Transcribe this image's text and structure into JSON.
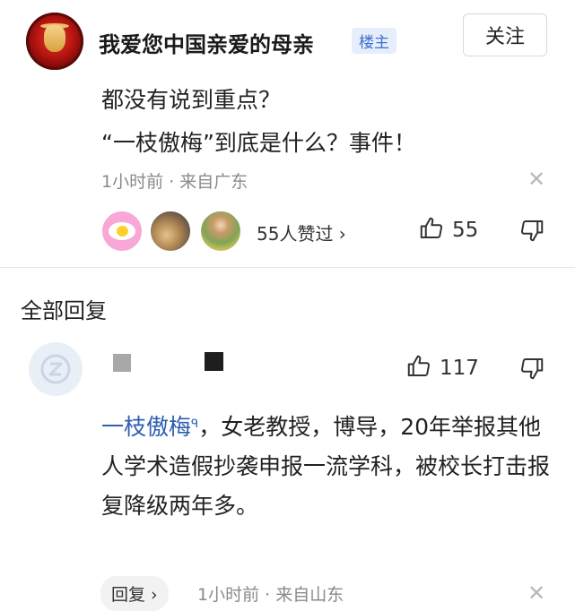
{
  "comment": {
    "username": "我爱您中国亲爱的母亲",
    "owner_badge": "楼主",
    "follow_label": "关注",
    "content_line1": "都没有说到重点？",
    "content_line2": "“一枝傲梅”到底是什么？事件！",
    "time_location": "1小时前 · 来自广东",
    "likes_summary": "55人赞过 ›",
    "like_count": "55"
  },
  "replies_section": {
    "title": "全部回复"
  },
  "reply": {
    "like_count": "117",
    "mention": "一枝傲梅",
    "text": "，女老教授，博导，20年举报其他人学术造假抄袭申报一流学科，被校长打击报复降级两年多。",
    "reply_button": "回复 ›",
    "time_location": "1小时前 · 来自山东"
  },
  "colors": {
    "mention": "#2e5fb3",
    "badge_text": "#3a6fd1",
    "badge_bg": "#e7eefb",
    "meta_text": "#8a8a8a"
  }
}
